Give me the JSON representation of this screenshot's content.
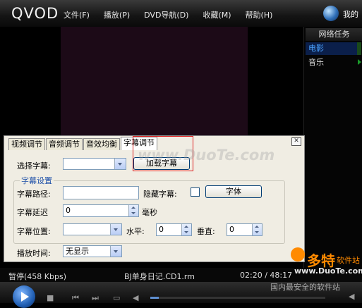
{
  "app": {
    "logo": "QVOD",
    "my_label": "我的"
  },
  "menu": [
    "文件(F)",
    "播放(P)",
    "DVD导航(D)",
    "收藏(M)",
    "帮助(H)"
  ],
  "right_panel": {
    "header": "网络任务",
    "items": [
      "电影",
      "音乐"
    ]
  },
  "dialog": {
    "tabs": [
      "视频调节",
      "音频调节",
      "音效均衡",
      "字幕调节"
    ],
    "active_tab": "字幕调节",
    "choose_subtitle_label": "选择字幕:",
    "choose_subtitle_value": "",
    "load_subtitle_button": "加载字幕",
    "group_title": "字幕设置",
    "subtitle_path_label": "字幕路径:",
    "subtitle_path_value": "",
    "hide_subtitle_label": "隐藏字幕:",
    "hide_subtitle_checked": false,
    "font_button": "字体",
    "subtitle_delay_label": "字幕延迟",
    "subtitle_delay_value": "0",
    "delay_unit": "毫秒",
    "subtitle_position_label": "字幕位置:",
    "subtitle_position_value": "",
    "horizontal_label": "水平:",
    "horizontal_value": "0",
    "vertical_label": "垂直:",
    "vertical_value": "0",
    "play_time_label": "播放时间:",
    "play_time_value": "无显示"
  },
  "watermark": "www.DuoTe.com",
  "status": {
    "state": "暂停(458 Kbps)",
    "filename": "BJ单身日记.CD1.rm",
    "time": "02:20 / 48:17",
    "progress": 0.05
  },
  "brand_overlay": {
    "big": "多特",
    "small": "软件站",
    "url": "www.DuoTe.com",
    "slogan": "国内最安全的软件站"
  }
}
